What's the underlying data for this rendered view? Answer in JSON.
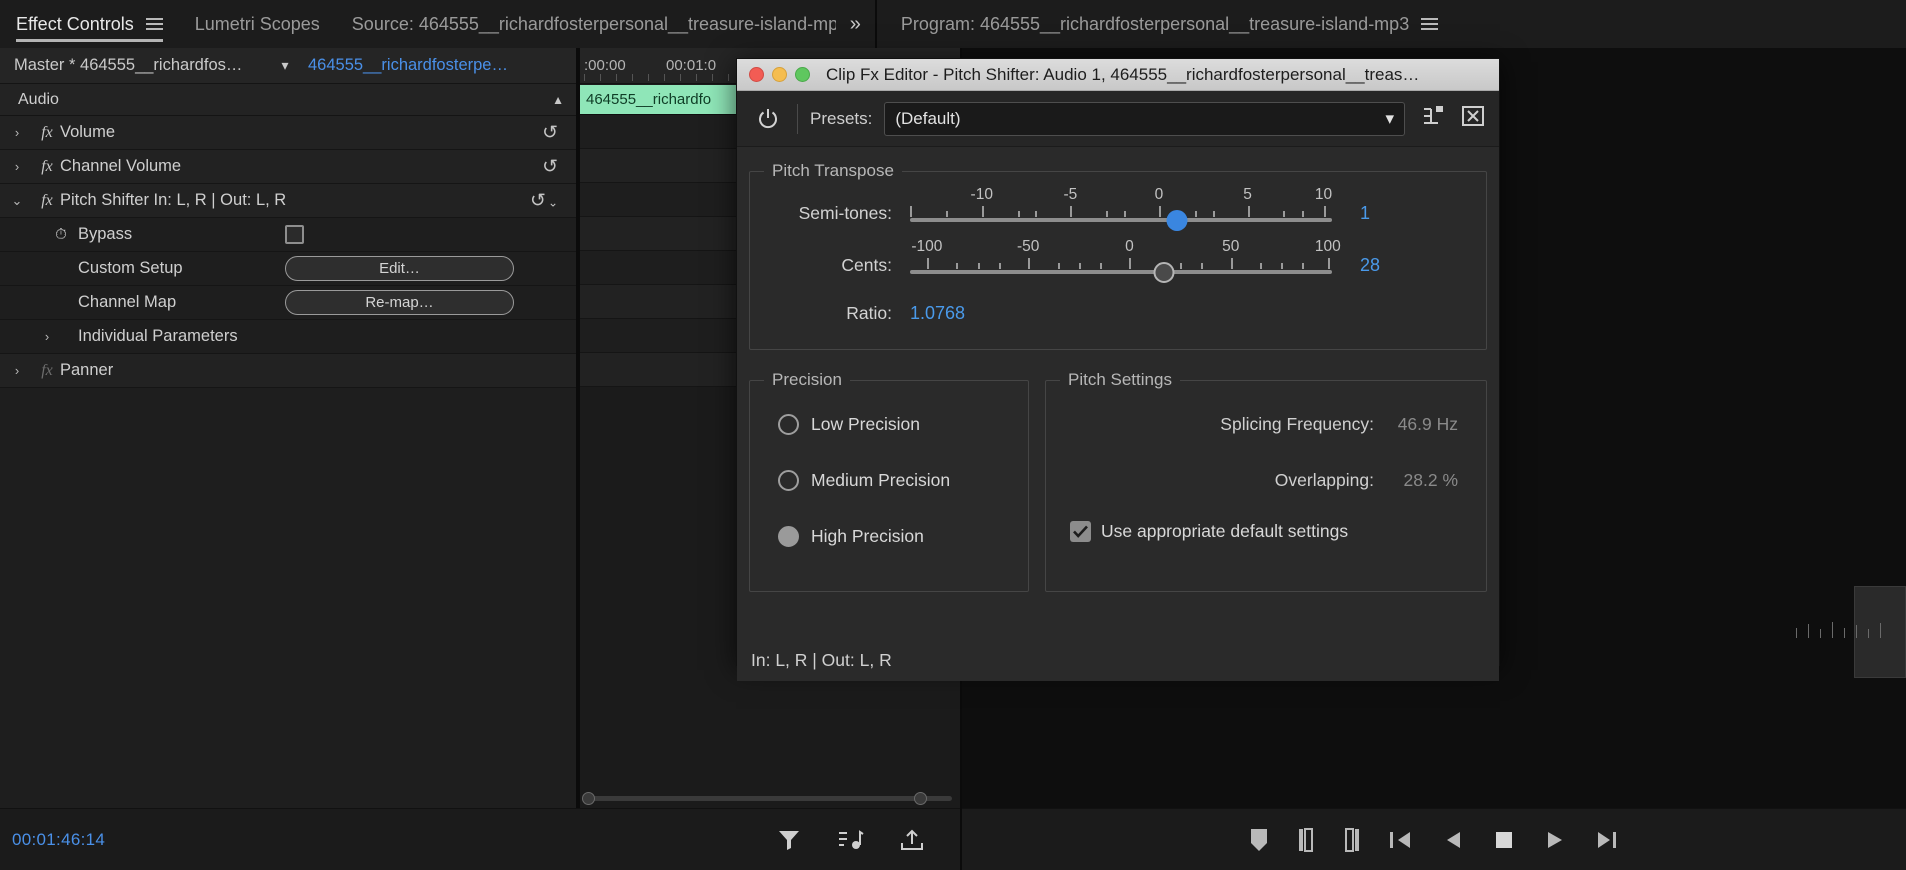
{
  "tabs": [
    {
      "label": "Effect Controls",
      "active": true,
      "menu_icon": "hamburger-icon"
    },
    {
      "label": "Lumetri Scopes",
      "active": false
    },
    {
      "label": "Source: 464555__richardfosterpersonal__treasure-island-mp3",
      "active": false
    }
  ],
  "tab_overflow_icon": "double-chevron-right-icon",
  "program_panel": {
    "title": "Program: 464555__richardfosterpersonal__treasure-island-mp3",
    "menu_icon": "hamburger-icon"
  },
  "effect_controls": {
    "master_label": "Master * 464555__richardfos…",
    "dropdown_icon": "chevron-down-icon",
    "clip_label": "464555__richardfosterpe…",
    "play_icon": "play-triangle-icon",
    "section_label": "Audio",
    "collapse_icon": "caret-up-icon",
    "rows": [
      {
        "name": "Volume",
        "arrow": "›",
        "fx": "fx",
        "reset": true
      },
      {
        "name": "Channel Volume",
        "arrow": "›",
        "fx": "fx",
        "reset": true
      },
      {
        "name": "Pitch Shifter In: L, R | Out: L, R",
        "arrow": "⌄",
        "fx": "fx",
        "reset": true
      },
      {
        "name": "Bypass",
        "stopwatch": true,
        "checkbox": true
      },
      {
        "name": "Custom Setup",
        "button": "Edit…"
      },
      {
        "name": "Channel Map",
        "button": "Re-map…"
      },
      {
        "name": "Individual Parameters",
        "arrow": "›"
      },
      {
        "name": "Panner",
        "arrow": "›",
        "fx": "fx"
      }
    ],
    "timecode": "00:01:46:14",
    "bottom_tools": [
      "filter-icon",
      "add-keyframe-audio-icon",
      "export-icon"
    ]
  },
  "timeline": {
    "ruler_labels": [
      ":00:00",
      "00:01:0"
    ],
    "clip_label": "464555__richardfo"
  },
  "dialog": {
    "title": "Clip Fx Editor - Pitch Shifter: Audio 1, 464555__richardfosterpersonal__treas…",
    "traffic_lights": [
      "close-button",
      "minimize-button",
      "maximize-button"
    ],
    "power_icon": "power-toggle-icon",
    "presets_label": "Presets:",
    "presets_value": "(Default)",
    "presets_caret": "chevron-down-icon",
    "header_icons": [
      "preset-save-icon",
      "preset-delete-icon"
    ],
    "pitch_transpose": {
      "legend": "Pitch Transpose",
      "semitones": {
        "label": "Semi-tones:",
        "value": "1",
        "tick_labels": [
          "-10",
          "-5",
          "0",
          "5",
          "10"
        ],
        "min": -12,
        "max": 12,
        "knob_color": "#3a86e0"
      },
      "cents": {
        "label": "Cents:",
        "value": "28",
        "tick_labels": [
          "-100",
          "-50",
          "0",
          "50",
          "100"
        ],
        "min": -100,
        "max": 100,
        "knob_color": "#4a4a4a"
      },
      "ratio": {
        "label": "Ratio:",
        "value": "1.0768"
      }
    },
    "precision": {
      "legend": "Precision",
      "options": [
        {
          "label": "Low Precision",
          "selected": false
        },
        {
          "label": "Medium Precision",
          "selected": false
        },
        {
          "label": "High Precision",
          "selected": true
        }
      ]
    },
    "pitch_settings": {
      "legend": "Pitch Settings",
      "rows": [
        {
          "label": "Splicing Frequency:",
          "value": "46.9 Hz"
        },
        {
          "label": "Overlapping:",
          "value": "28.2 %"
        }
      ],
      "checkbox": {
        "label": "Use appropriate default settings",
        "checked": true
      }
    },
    "io_line": "In: L, R | Out: L, R"
  },
  "program_transport": {
    "buttons": [
      "marker-icon",
      "mark-in-icon",
      "mark-out-icon",
      "go-to-in-icon",
      "step-back-icon",
      "stop-icon",
      "play-icon",
      "step-forward-icon"
    ]
  },
  "colors": {
    "accent_blue": "#4a9aea",
    "clip_green": "#8fe6b8",
    "panel_bg": "#1e1e1e",
    "dialog_bg": "#2a2a2a"
  }
}
